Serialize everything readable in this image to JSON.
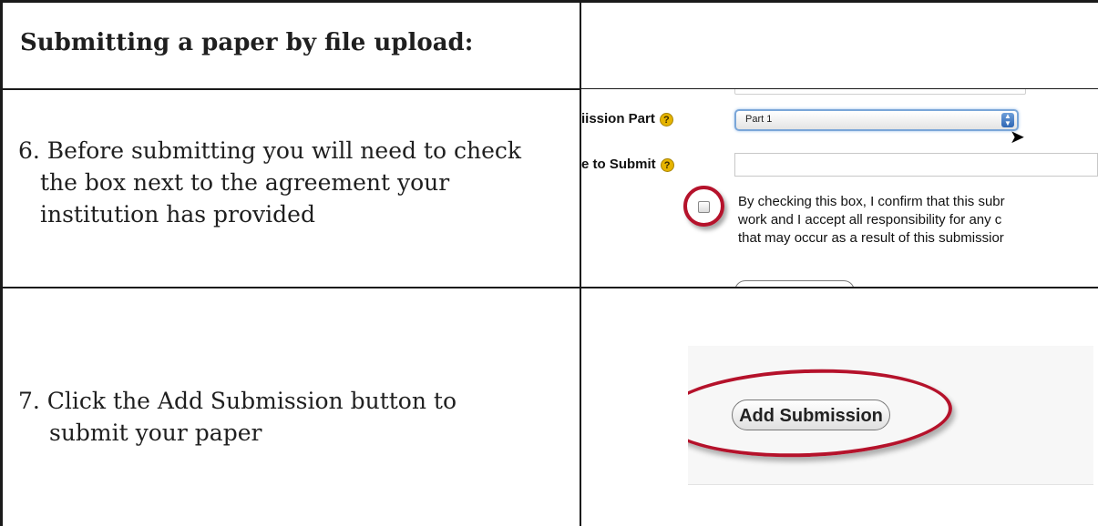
{
  "header": {
    "title": "Submitting a paper by file upload:"
  },
  "steps": [
    {
      "lines": [
        "6. Before submitting you will need to check",
        "the box next to the agreement your",
        "institution has provided"
      ]
    },
    {
      "lines": [
        "7. Click the Add Submission button to",
        "submit your paper"
      ]
    }
  ],
  "screenshot1": {
    "submission_part_label": "iission Part",
    "file_to_submit_label": "e to Submit",
    "help_glyph": "?",
    "select_value": "Part 1",
    "agreement_lines": [
      "By checking this box, I confirm that this subr",
      "work and I accept all responsibility for any c",
      "that may occur as a result of this submissior"
    ],
    "highlight_color": "#b5122b"
  },
  "screenshot2": {
    "button_label": "Add Submission"
  },
  "icons": [
    "help-icon",
    "select-arrows-icon",
    "mouse-cursor-icon",
    "checkbox-icon"
  ]
}
